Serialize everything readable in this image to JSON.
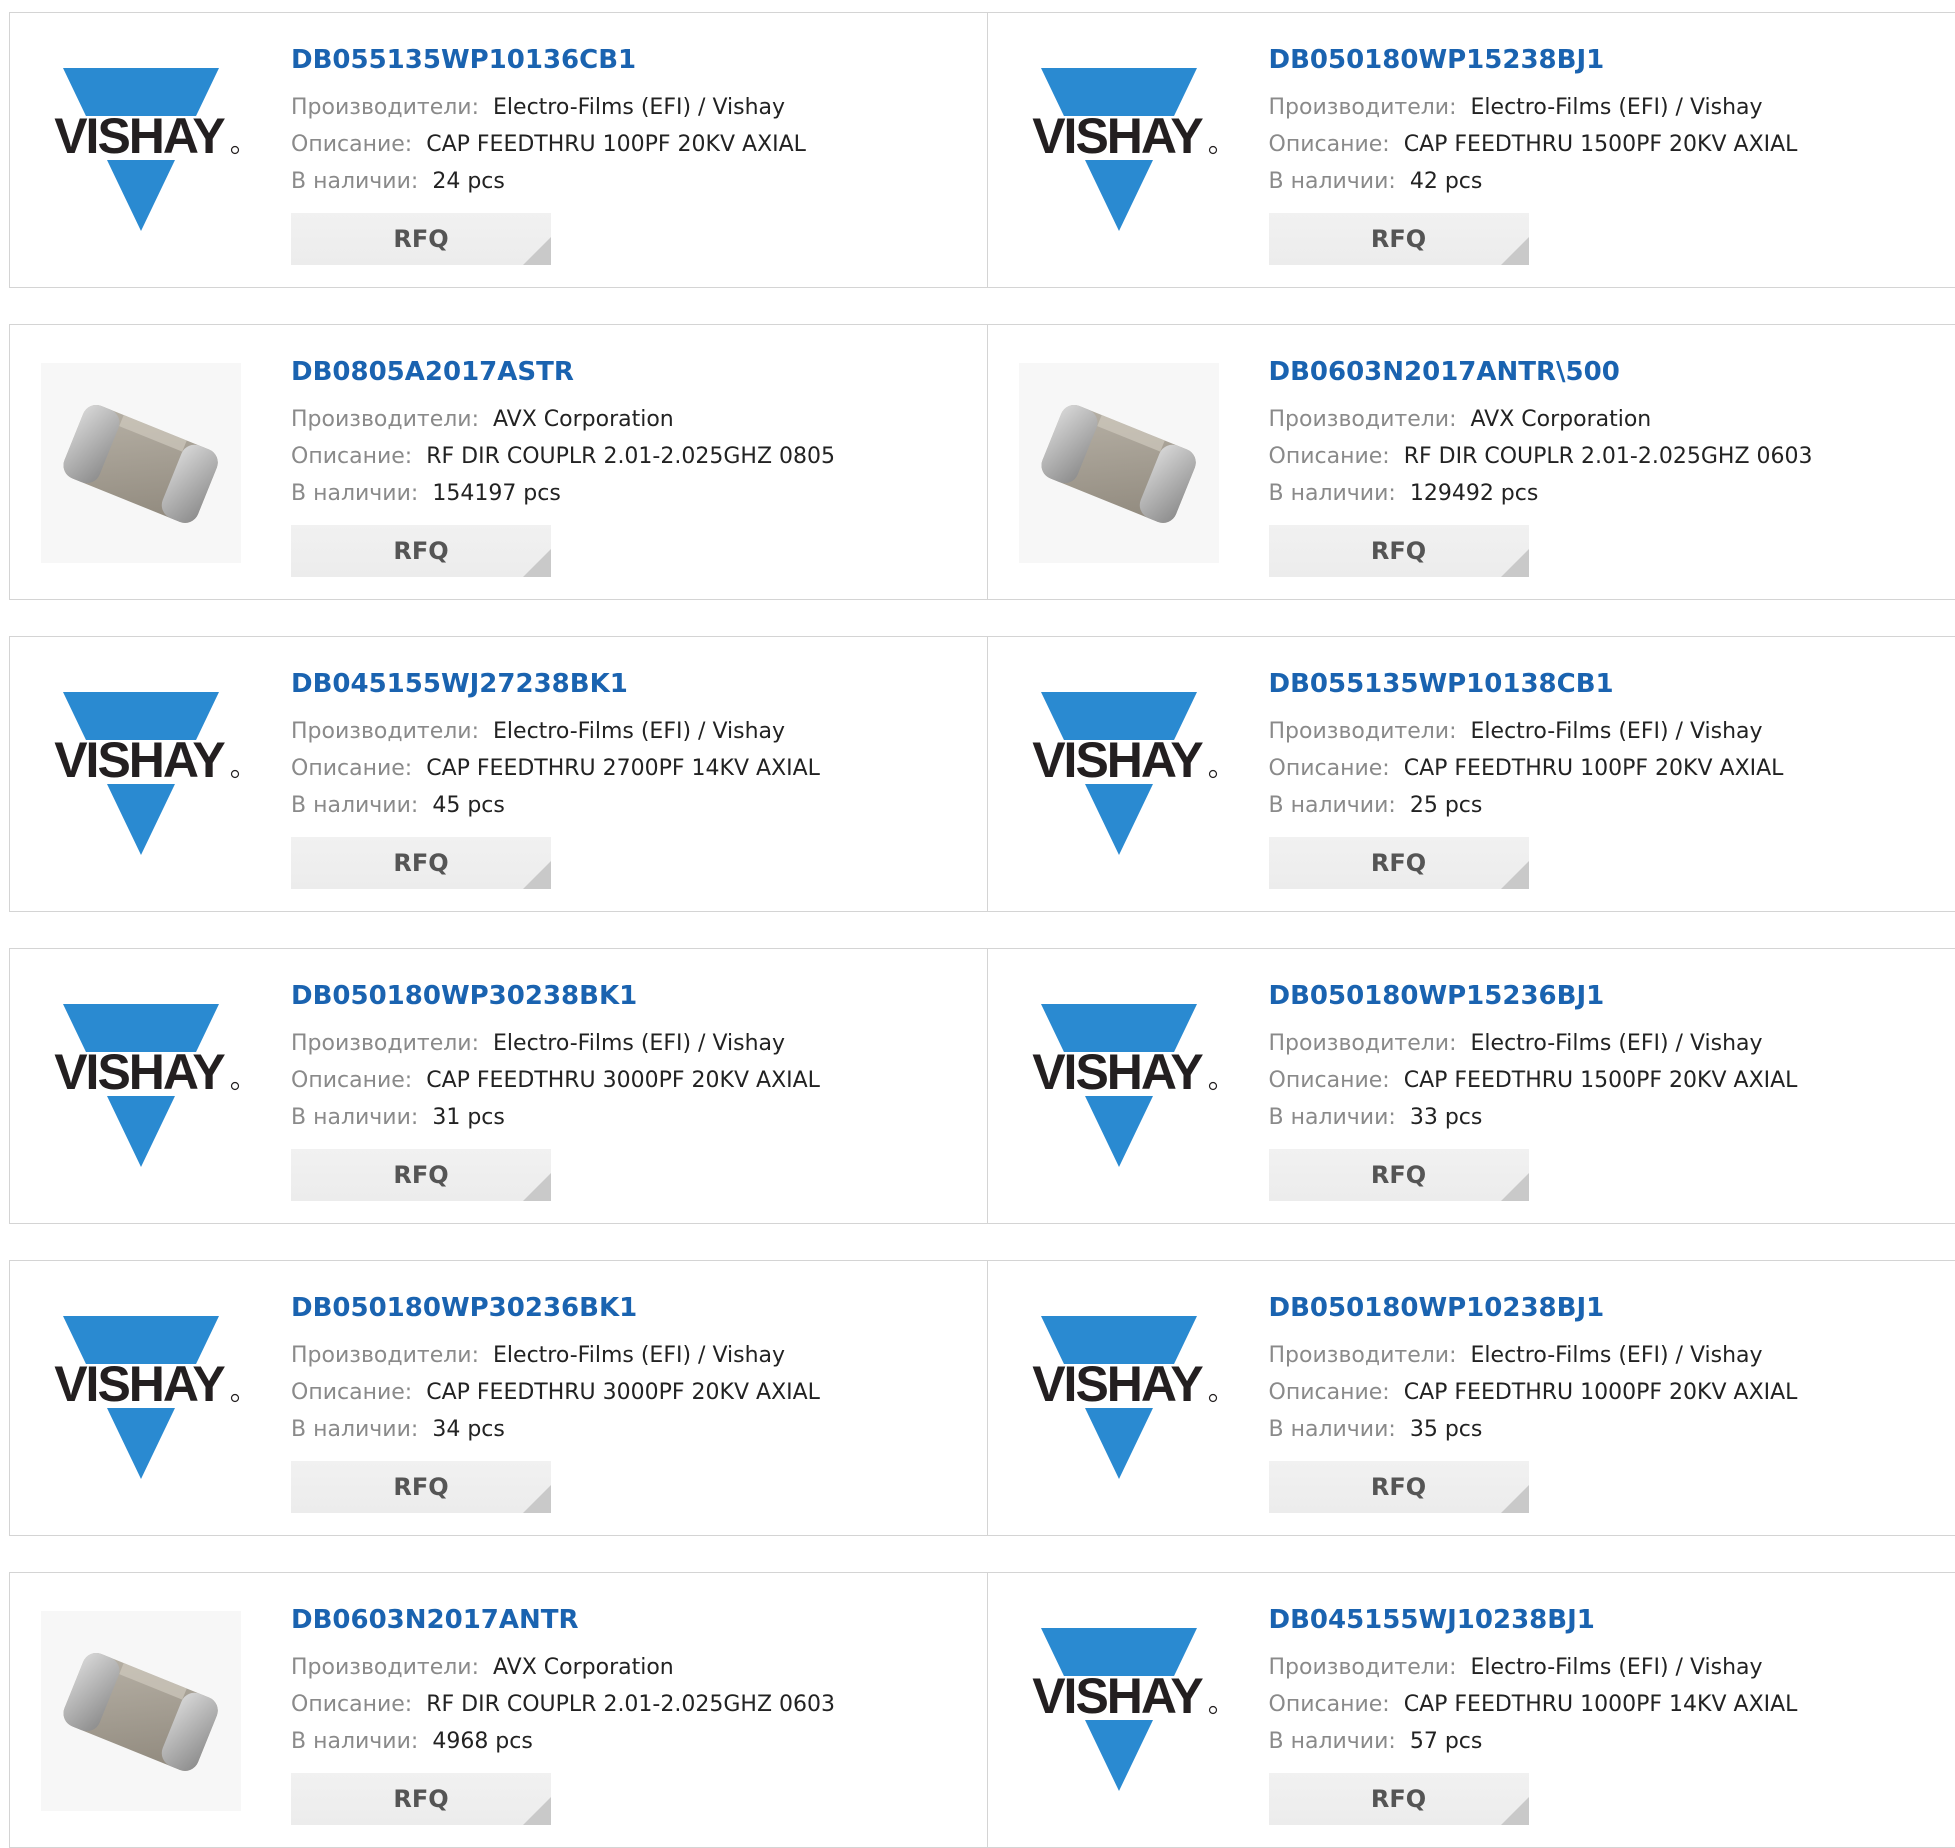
{
  "labels": {
    "manufacturer": "Производители:",
    "description": "Описание:",
    "stock": "В наличии:"
  },
  "colors": {
    "part_link": "#1a63b0",
    "vishay_blue": "#2a8ad1",
    "card_border": "#d4d4d4",
    "rfq_bg": "#ececec"
  },
  "rows": [
    {
      "left": {
        "part": "DB055135WP10136CB1",
        "manufacturer": "Electro-Films (EFI) / Vishay",
        "description": "CAP FEEDTHRU 100PF 20KV AXIAL",
        "stock": "24 pcs",
        "rfq": "RFQ",
        "image": "vishay-logo"
      },
      "right": {
        "part": "DB050180WP15238BJ1",
        "manufacturer": "Electro-Films (EFI) / Vishay",
        "description": "CAP FEEDTHRU 1500PF 20KV AXIAL",
        "stock": "42 pcs",
        "rfq": "RFQ",
        "image": "vishay-logo"
      }
    },
    {
      "left": {
        "part": "DB0805A2017ASTR",
        "manufacturer": "AVX Corporation",
        "description": "RF DIR COUPLR 2.01-2.025GHZ 0805",
        "stock": "154197 pcs",
        "rfq": "RFQ",
        "image": "smd-chip-photo"
      },
      "right": {
        "part": "DB0603N2017ANTR\\500",
        "manufacturer": "AVX Corporation",
        "description": "RF DIR COUPLR 2.01-2.025GHZ 0603",
        "stock": "129492 pcs",
        "rfq": "RFQ",
        "image": "smd-chip-photo"
      }
    },
    {
      "left": {
        "part": "DB045155WJ27238BK1",
        "manufacturer": "Electro-Films (EFI) / Vishay",
        "description": "CAP FEEDTHRU 2700PF 14KV AXIAL",
        "stock": "45 pcs",
        "rfq": "RFQ",
        "image": "vishay-logo"
      },
      "right": {
        "part": "DB055135WP10138CB1",
        "manufacturer": "Electro-Films (EFI) / Vishay",
        "description": "CAP FEEDTHRU 100PF 20KV AXIAL",
        "stock": "25 pcs",
        "rfq": "RFQ",
        "image": "vishay-logo"
      }
    },
    {
      "left": {
        "part": "DB050180WP30238BK1",
        "manufacturer": "Electro-Films (EFI) / Vishay",
        "description": "CAP FEEDTHRU 3000PF 20KV AXIAL",
        "stock": "31 pcs",
        "rfq": "RFQ",
        "image": "vishay-logo"
      },
      "right": {
        "part": "DB050180WP15236BJ1",
        "manufacturer": "Electro-Films (EFI) / Vishay",
        "description": "CAP FEEDTHRU 1500PF 20KV AXIAL",
        "stock": "33 pcs",
        "rfq": "RFQ",
        "image": "vishay-logo"
      }
    },
    {
      "left": {
        "part": "DB050180WP30236BK1",
        "manufacturer": "Electro-Films (EFI) / Vishay",
        "description": "CAP FEEDTHRU 3000PF 20KV AXIAL",
        "stock": "34 pcs",
        "rfq": "RFQ",
        "image": "vishay-logo"
      },
      "right": {
        "part": "DB050180WP10238BJ1",
        "manufacturer": "Electro-Films (EFI) / Vishay",
        "description": "CAP FEEDTHRU 1000PF 20KV AXIAL",
        "stock": "35 pcs",
        "rfq": "RFQ",
        "image": "vishay-logo"
      }
    },
    {
      "left": {
        "part": "DB0603N2017ANTR",
        "manufacturer": "AVX Corporation",
        "description": "RF DIR COUPLR 2.01-2.025GHZ 0603",
        "stock": "4968 pcs",
        "rfq": "RFQ",
        "image": "smd-chip-photo"
      },
      "right": {
        "part": "DB045155WJ10238BJ1",
        "manufacturer": "Electro-Films (EFI) / Vishay",
        "description": "CAP FEEDTHRU 1000PF 14KV AXIAL",
        "stock": "57 pcs",
        "rfq": "RFQ",
        "image": "vishay-logo"
      }
    }
  ]
}
